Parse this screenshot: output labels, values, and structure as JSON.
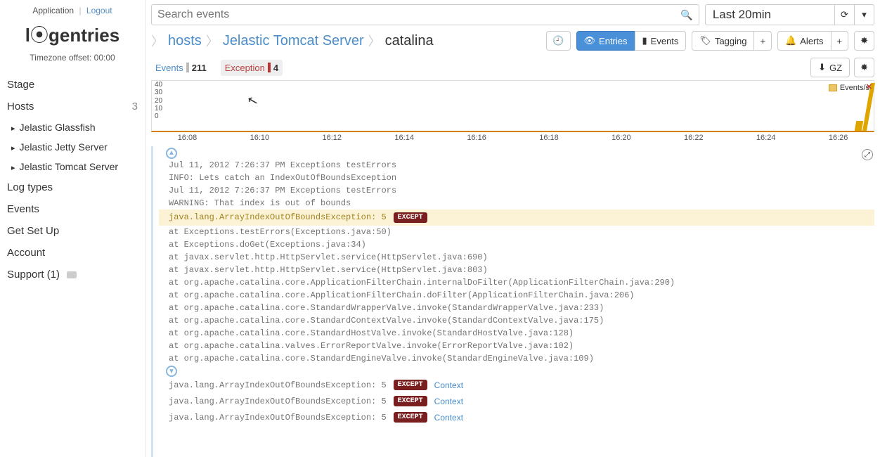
{
  "header": {
    "application_link": "Application",
    "logout_link": "Logout",
    "logo_left": "l",
    "logo_sym": "⦿",
    "logo_right": "gentries",
    "timezone": "Timezone offset: 00:00"
  },
  "sidebar": {
    "stage": "Stage",
    "hosts_label": "Hosts",
    "hosts_count": "3",
    "hosts": [
      "Jelastic Glassfish",
      "Jelastic Jetty Server",
      "Jelastic Tomcat Server"
    ],
    "log_types": "Log types",
    "events": "Events",
    "get_set_up": "Get Set Up",
    "account": "Account",
    "support": "Support (1)"
  },
  "search": {
    "placeholder": "Search events"
  },
  "timepicker": {
    "label": "Last 20min",
    "refresh": "⟳",
    "caret": "▾"
  },
  "breadcrumb": {
    "hosts": "hosts",
    "server": "Jelastic Tomcat Server",
    "log": "catalina"
  },
  "toolbar": {
    "clock_icon": "🕘",
    "entries": "Entries",
    "events": "Events",
    "tagging": "Tagging",
    "plus": "+",
    "alerts": "Alerts",
    "gear": "✸",
    "entries_icon": "👁",
    "events_icon": "▮",
    "tag_icon": "🏷",
    "bell_icon": "🔔"
  },
  "tabs": {
    "events_label": "Events",
    "events_count": "211",
    "exception_label": "Exception",
    "exception_count": "4",
    "gz_label": "GZ",
    "dl_icon": "⬇",
    "gear": "✸"
  },
  "chart_data": {
    "type": "line",
    "title": "",
    "xlabel": "",
    "ylabel": "",
    "ylim": [
      0,
      40
    ],
    "yticks": [
      0,
      10,
      20,
      30,
      40
    ],
    "x_ticks": [
      "16:08",
      "16:10",
      "16:12",
      "16:14",
      "16:16",
      "16:18",
      "16:20",
      "16:22",
      "16:24",
      "16:26"
    ],
    "series": [
      {
        "name": "Events/s",
        "color": "#d4a017",
        "x": [
          "16:08",
          "16:10",
          "16:12",
          "16:14",
          "16:16",
          "16:18",
          "16:20",
          "16:22",
          "16:23",
          "16:24",
          "16:25",
          "16:26",
          "16:26.5"
        ],
        "y": [
          0,
          0,
          0,
          0,
          0,
          0,
          0,
          0,
          1,
          0,
          4,
          1,
          40
        ]
      }
    ],
    "legend": "Events/s"
  },
  "log": {
    "pre_lines": [
      "Jul 11, 2012 7:26:37 PM Exceptions testErrors",
      "INFO: Lets catch an IndexOutOfBoundsException",
      "Jul 11, 2012 7:26:37 PM Exceptions testErrors",
      "WARNING: That index is out of bounds"
    ],
    "highlight_text": "java.lang.ArrayIndexOutOfBoundsException: 5",
    "except_badge": "EXCEPT",
    "stack": [
      "at Exceptions.testErrors(Exceptions.java:50)",
      "at Exceptions.doGet(Exceptions.java:34)",
      "at javax.servlet.http.HttpServlet.service(HttpServlet.java:690)",
      "at javax.servlet.http.HttpServlet.service(HttpServlet.java:803)",
      "at org.apache.catalina.core.ApplicationFilterChain.internalDoFilter(ApplicationFilterChain.java:290)",
      "at org.apache.catalina.core.ApplicationFilterChain.doFilter(ApplicationFilterChain.java:206)",
      "at org.apache.catalina.core.StandardWrapperValve.invoke(StandardWrapperValve.java:233)",
      "at org.apache.catalina.core.StandardContextValve.invoke(StandardContextValve.java:175)",
      "at org.apache.catalina.core.StandardHostValve.invoke(StandardHostValve.java:128)",
      "at org.apache.catalina.valves.ErrorReportValve.invoke(ErrorReportValve.java:102)",
      "at org.apache.catalina.core.StandardEngineValve.invoke(StandardEngineValve.java:109)"
    ],
    "repeat_text": "java.lang.ArrayIndexOutOfBoundsException: 5",
    "context": "Context"
  }
}
